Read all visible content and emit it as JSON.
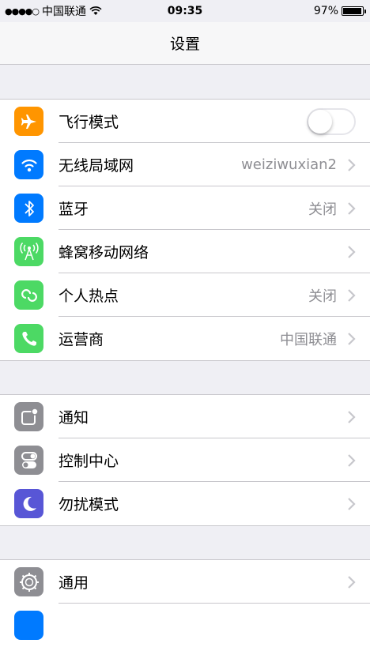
{
  "status_bar": {
    "signal": "●●●●○",
    "carrier": "中国联通",
    "time": "09:35",
    "battery_text": "97%",
    "battery_level": 0.97
  },
  "nav": {
    "title": "设置"
  },
  "groups": [
    {
      "rows": [
        {
          "label": "飞行模式",
          "icon": "airplane-icon",
          "color": "#ff9500",
          "toggle": false
        },
        {
          "label": "无线局域网",
          "icon": "wifi-icon",
          "color": "#007aff",
          "value": "weiziwuxian2"
        },
        {
          "label": "蓝牙",
          "icon": "bluetooth-icon",
          "color": "#007aff",
          "value": "关闭"
        },
        {
          "label": "蜂窝移动网络",
          "icon": "cellular-icon",
          "color": "#4cd964"
        },
        {
          "label": "个人热点",
          "icon": "hotspot-icon",
          "color": "#4cd964",
          "value": "关闭"
        },
        {
          "label": "运营商",
          "icon": "phone-icon",
          "color": "#4cd964",
          "value": "中国联通"
        }
      ]
    },
    {
      "rows": [
        {
          "label": "通知",
          "icon": "notifications-icon",
          "color": "#8e8e93"
        },
        {
          "label": "控制中心",
          "icon": "control-center-icon",
          "color": "#8e8e93"
        },
        {
          "label": "勿扰模式",
          "icon": "moon-icon",
          "color": "#5856d6"
        }
      ]
    },
    {
      "rows": [
        {
          "label": "通用",
          "icon": "gear-icon",
          "color": "#8e8e93"
        }
      ]
    }
  ]
}
